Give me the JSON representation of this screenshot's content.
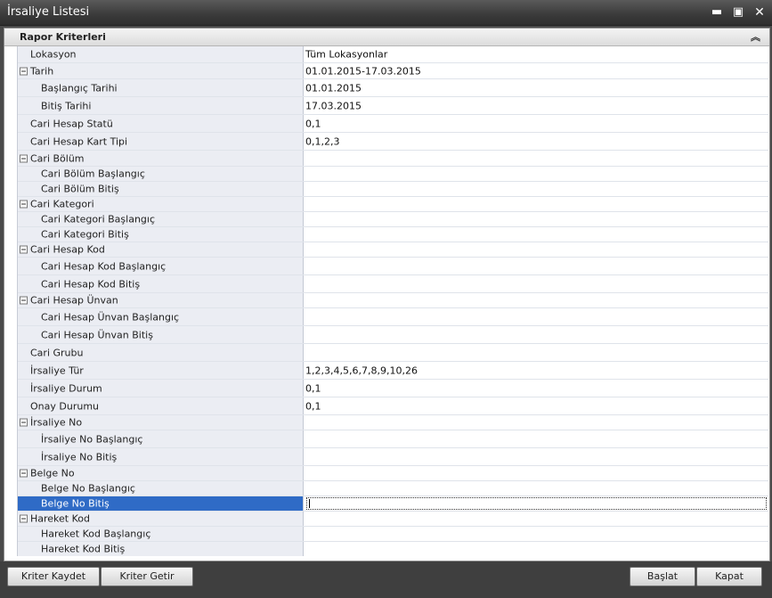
{
  "window": {
    "title": "İrsaliye Listesi"
  },
  "panel": {
    "title": "Rapor Kriterleri"
  },
  "rows": [
    {
      "label": "Lokasyon",
      "value": "Tüm Lokasyonlar"
    },
    {
      "label": "Tarih",
      "value": "01.01.2015-17.03.2015"
    },
    {
      "label": "Başlangıç Tarihi",
      "value": "01.01.2015"
    },
    {
      "label": "Bitiş Tarihi",
      "value": "17.03.2015"
    },
    {
      "label": "Cari Hesap Statü",
      "value": "0,1"
    },
    {
      "label": "Cari Hesap Kart Tipi",
      "value": "0,1,2,3"
    },
    {
      "label": "Cari Bölüm",
      "value": ""
    },
    {
      "label": "Cari Bölüm Başlangıç",
      "value": ""
    },
    {
      "label": "Cari Bölüm Bitiş",
      "value": ""
    },
    {
      "label": "Cari Kategori",
      "value": ""
    },
    {
      "label": "Cari Kategori Başlangıç",
      "value": ""
    },
    {
      "label": "Cari Kategori Bitiş",
      "value": ""
    },
    {
      "label": "Cari Hesap Kod",
      "value": ""
    },
    {
      "label": "Cari Hesap Kod Başlangıç",
      "value": ""
    },
    {
      "label": "Cari Hesap Kod Bitiş",
      "value": ""
    },
    {
      "label": "Cari Hesap Ünvan",
      "value": ""
    },
    {
      "label": "Cari Hesap Ünvan Başlangıç",
      "value": ""
    },
    {
      "label": "Cari Hesap Ünvan Bitiş",
      "value": ""
    },
    {
      "label": "Cari Grubu",
      "value": ""
    },
    {
      "label": "İrsaliye Tür",
      "value": "1,2,3,4,5,6,7,8,9,10,26"
    },
    {
      "label": "İrsaliye Durum",
      "value": "0,1"
    },
    {
      "label": "Onay Durumu",
      "value": "0,1"
    },
    {
      "label": "İrsaliye No",
      "value": ""
    },
    {
      "label": "İrsaliye No Başlangıç",
      "value": ""
    },
    {
      "label": "İrsaliye No Bitiş",
      "value": ""
    },
    {
      "label": "Belge No",
      "value": ""
    },
    {
      "label": "Belge No Başlangıç",
      "value": ""
    },
    {
      "label": "Belge No Bitiş",
      "value": ""
    },
    {
      "label": "Hareket Kod",
      "value": ""
    },
    {
      "label": "Hareket Kod Başlangıç",
      "value": ""
    },
    {
      "label": "Hareket Kod Bitiş",
      "value": ""
    }
  ],
  "buttons": {
    "save_criteria": "Kriter Kaydet",
    "load_criteria": "Kriter Getir",
    "start": "Başlat",
    "close": "Kapat"
  },
  "colors": {
    "selection": "#2f6bc6",
    "category_bg": "#ebedf3"
  }
}
